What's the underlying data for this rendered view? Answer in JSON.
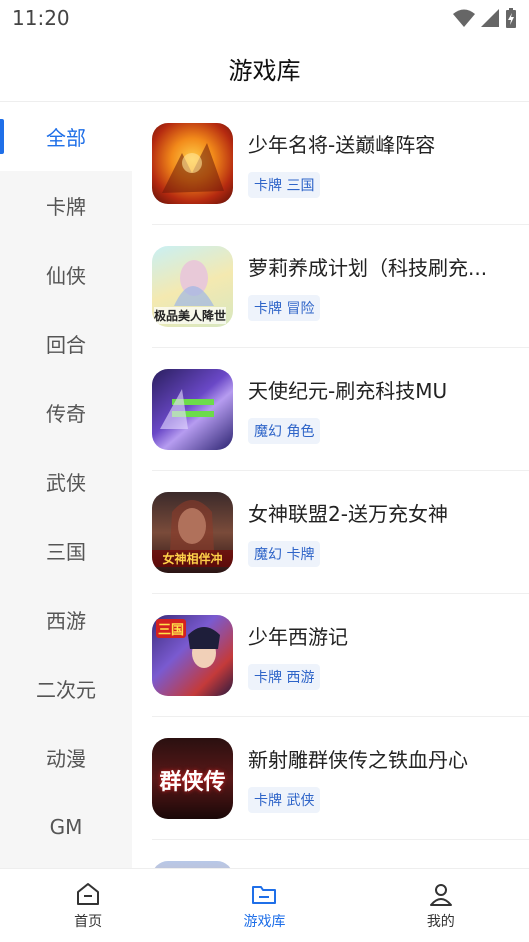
{
  "status_bar": {
    "time": "11:20"
  },
  "header": {
    "title": "游戏库"
  },
  "sidebar": {
    "items": [
      {
        "label": "全部",
        "active": true
      },
      {
        "label": "卡牌"
      },
      {
        "label": "仙侠"
      },
      {
        "label": "回合"
      },
      {
        "label": "传奇"
      },
      {
        "label": "武侠"
      },
      {
        "label": "三国"
      },
      {
        "label": "西游"
      },
      {
        "label": "二次元"
      },
      {
        "label": "动漫"
      },
      {
        "label": "GM"
      }
    ]
  },
  "games": [
    {
      "name": "少年名将-送巅峰阵容",
      "tags": "卡牌 三国"
    },
    {
      "name": "萝莉养成计划（科技刷充...",
      "tags": "卡牌 冒险",
      "icon_text": "极品美人降世"
    },
    {
      "name": "天使纪元-刷充科技MU",
      "tags": "魔幻 角色"
    },
    {
      "name": "女神联盟2-送万充女神",
      "tags": "魔幻 卡牌",
      "icon_text": "女神相伴冲"
    },
    {
      "name": "少年西游记",
      "tags": "卡牌 西游",
      "icon_text": "三国"
    },
    {
      "name": "新射雕群侠传之铁血丹心",
      "tags": "卡牌 武侠",
      "icon_text": "群侠传"
    }
  ],
  "tabbar": {
    "tabs": [
      {
        "label": "首页",
        "icon": "home-icon"
      },
      {
        "label": "游戏库",
        "icon": "folder-icon",
        "active": true
      },
      {
        "label": "我的",
        "icon": "profile-icon"
      }
    ]
  },
  "colors": {
    "accent": "#1f6fe8",
    "tag_bg": "#eef3fb",
    "tag_text": "#2e64c8"
  }
}
